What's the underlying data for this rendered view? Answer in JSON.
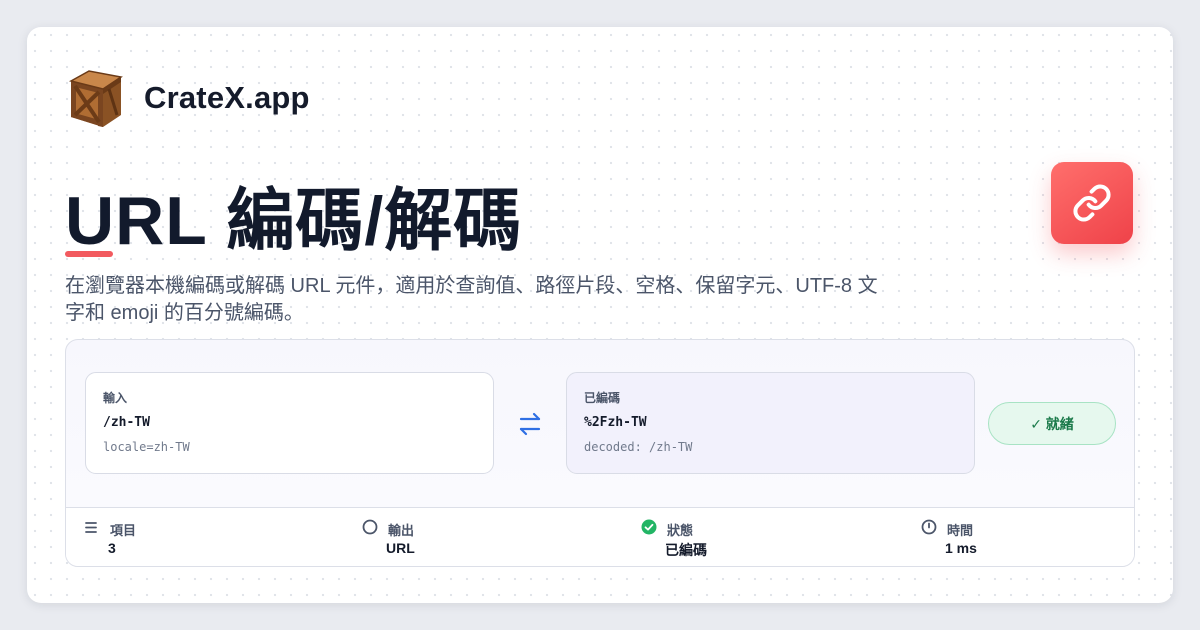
{
  "brand": {
    "name": "CrateX.app",
    "logo_icon": "crate-icon"
  },
  "page": {
    "title": "URL 編碼/解碼",
    "description": "在瀏覽器本機編碼或解碼 URL 元件，適用於查詢值、路徑片段、空格、保留字元、UTF-8 文字和 emoji 的百分號編碼。",
    "accent_color": "#f25a5f",
    "tool_icon": "link-icon"
  },
  "converter": {
    "input": {
      "label": "輸入",
      "value": "/zh-TW",
      "sub": "locale=zh-TW"
    },
    "swap_icon": "swap-arrows-icon",
    "output": {
      "label": "已編碼",
      "value": "%2Fzh-TW",
      "sub": "decoded: /zh-TW"
    },
    "status_label": "✓ 就緒"
  },
  "stats": [
    {
      "icon": "list-icon",
      "label": "項目",
      "value": "3"
    },
    {
      "icon": "circle-icon",
      "label": "輸出",
      "value": "URL"
    },
    {
      "icon": "check-circle-icon",
      "label": "狀態",
      "value": "已編碼"
    },
    {
      "icon": "clock-icon",
      "label": "時間",
      "value": "1 ms"
    }
  ]
}
